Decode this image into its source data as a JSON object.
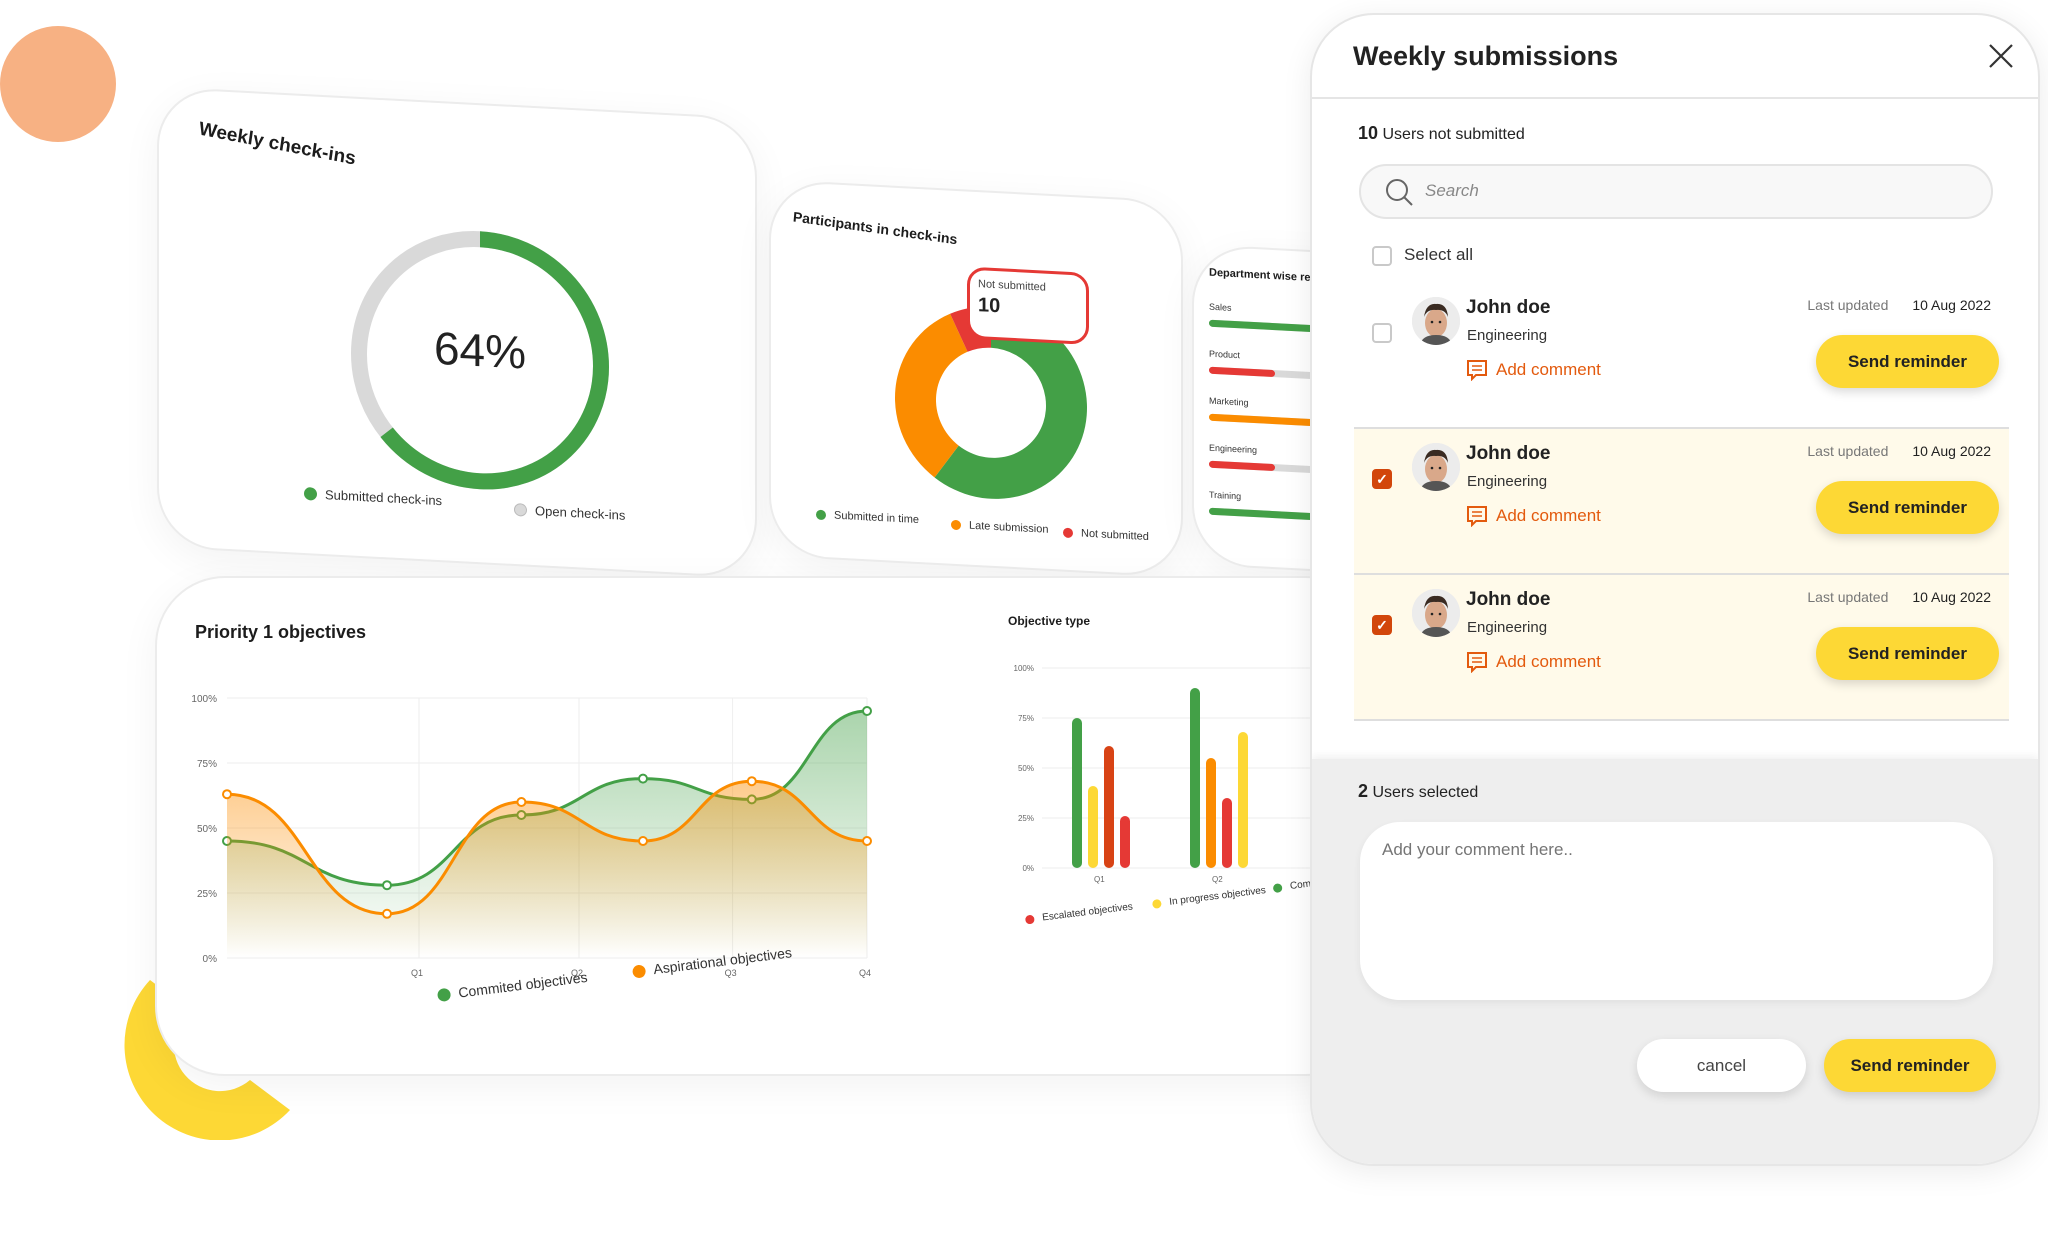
{
  "colors": {
    "green": "#43a047",
    "orange": "#fb8c00",
    "red": "#e53935",
    "yellow": "#fdd835",
    "grey": "#d9d9d9",
    "accent": "#e35a0e"
  },
  "weekly_checkins": {
    "title": "Weekly check-ins",
    "percent_label": "64%",
    "percent": 64,
    "legend": [
      "Submitted check-ins",
      "Open check-ins"
    ]
  },
  "participants": {
    "title": "Participants in check-ins",
    "tooltip_label": "Not submitted",
    "tooltip_value": "10",
    "legend": [
      "Submitted in time",
      "Late submission",
      "Not submitted"
    ],
    "shares": [
      60,
      33,
      7
    ]
  },
  "department": {
    "title": "Department wise refl",
    "items": [
      {
        "label": "Sales",
        "value": 0.95,
        "color": "#43a047"
      },
      {
        "label": "Product",
        "value": 0.6,
        "color": "#e53935"
      },
      {
        "label": "Marketing",
        "value": 0.95,
        "color": "#fb8c00"
      },
      {
        "label": "Engineering",
        "value": 0.6,
        "color": "#e53935"
      },
      {
        "label": "Training",
        "value": 0.95,
        "color": "#43a047"
      }
    ]
  },
  "chart_data": [
    {
      "type": "area",
      "title": "Priority 1 objectives",
      "yticks": [
        "100%",
        "75%",
        "50%",
        "25%",
        "0%"
      ],
      "xticks": [
        "Q1",
        "Q2",
        "Q3",
        "Q4"
      ],
      "ylim": [
        0,
        100
      ],
      "series": [
        {
          "name": "Commited objectives",
          "color": "#43a047",
          "values": [
            45,
            28,
            55,
            69,
            61,
            95
          ]
        },
        {
          "name": "Aspirational objectives",
          "color": "#fb8c00",
          "values": [
            63,
            17,
            60,
            45,
            68,
            45
          ]
        }
      ]
    },
    {
      "type": "bar",
      "title": "Objective type",
      "yticks": [
        "100%",
        "75%",
        "50%",
        "25%",
        "0%"
      ],
      "categories": [
        "Q1",
        "Q2"
      ],
      "ylim": [
        0,
        100
      ],
      "groups": [
        [
          {
            "v": 75,
            "c": "#43a047"
          },
          {
            "v": 41,
            "c": "#fdd835"
          },
          {
            "v": 61,
            "c": "#d84315"
          },
          {
            "v": 26,
            "c": "#e53935"
          }
        ],
        [
          {
            "v": 90,
            "c": "#43a047"
          },
          {
            "v": 55,
            "c": "#fb8c00"
          },
          {
            "v": 35,
            "c": "#e53935"
          },
          {
            "v": 68,
            "c": "#fdd835"
          }
        ]
      ],
      "legend": [
        {
          "name": "Escalated objectives",
          "color": "#e53935"
        },
        {
          "name": "In progress objectives",
          "color": "#fdd835"
        },
        {
          "name": "Comple",
          "color": "#43a047"
        }
      ]
    }
  ],
  "panel": {
    "title": "Weekly submissions",
    "not_submitted_count": "10",
    "not_submitted_label": "Users not submitted",
    "search_placeholder": "Search",
    "select_all": "Select all",
    "users": [
      {
        "name": "John doe",
        "dept": "Engineering",
        "last_updated_label": "Last updated",
        "date": "10 Aug 2022",
        "add_comment": "Add comment",
        "button": "Send reminder",
        "checked": false
      },
      {
        "name": "John doe",
        "dept": "Engineering",
        "last_updated_label": "Last updated",
        "date": "10 Aug 2022",
        "add_comment": "Add comment",
        "button": "Send reminder",
        "checked": true
      },
      {
        "name": "John doe",
        "dept": "Engineering",
        "last_updated_label": "Last updated",
        "date": "10 Aug 2022",
        "add_comment": "Add comment",
        "button": "Send reminder",
        "checked": true
      }
    ],
    "selected_count": "2",
    "selected_label": "Users selected",
    "comment_placeholder": "Add your comment here..",
    "cancel": "cancel",
    "send": "Send reminder"
  }
}
